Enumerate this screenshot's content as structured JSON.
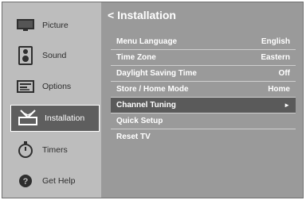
{
  "sidebar": {
    "items": [
      {
        "label": "Picture",
        "icon": "monitor-icon"
      },
      {
        "label": "Sound",
        "icon": "speaker-icon"
      },
      {
        "label": "Options",
        "icon": "options-panel-icon"
      },
      {
        "label": "Installation",
        "icon": "antenna-icon"
      },
      {
        "label": "Timers",
        "icon": "stopwatch-icon"
      },
      {
        "label": "Get Help",
        "icon": "help-icon"
      }
    ],
    "active_index": 3
  },
  "main": {
    "title": "< Installation",
    "rows": [
      {
        "label": "Menu Language",
        "value": "English"
      },
      {
        "label": "Time Zone",
        "value": "Eastern"
      },
      {
        "label": "Daylight Saving Time",
        "value": "Off"
      },
      {
        "label": "Store / Home Mode",
        "value": "Home"
      },
      {
        "label": "Channel Tuning",
        "value": "►"
      },
      {
        "label": "Quick Setup",
        "value": ""
      },
      {
        "label": "Reset TV",
        "value": ""
      }
    ],
    "selected_index": 4
  },
  "colors": {
    "background": "#9a9a9a",
    "sidebar": "#bdbdbd",
    "selected": "#5a5a5a",
    "text": "#ffffff"
  }
}
